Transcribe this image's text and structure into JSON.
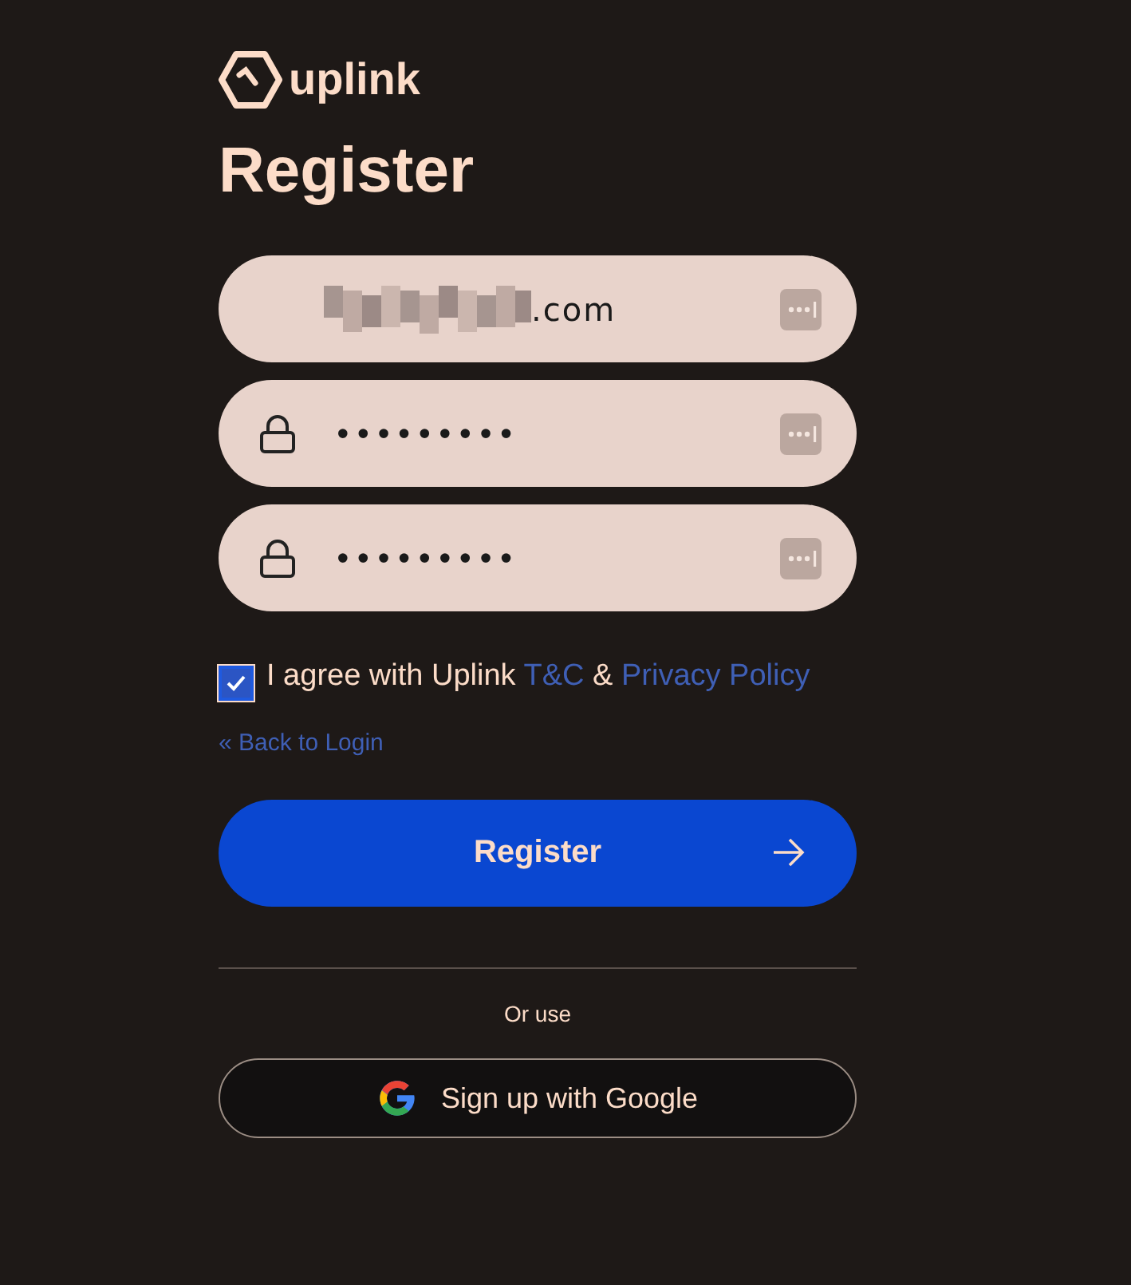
{
  "brand": {
    "name": "uplink"
  },
  "title": "Register",
  "fields": [
    {
      "kind": "email",
      "value": ".com",
      "redacted": true
    },
    {
      "kind": "password",
      "value": "•••••••••"
    },
    {
      "kind": "password",
      "value": "•••••••••"
    }
  ],
  "agree": {
    "checked": true,
    "text": "I agree with Uplink",
    "links": [
      "T&C",
      "Privacy Policy"
    ],
    "joiner": "&"
  },
  "back_link": "« Back to Login",
  "submit": {
    "label": "Register"
  },
  "divider_text": "Or use",
  "google_button": {
    "label": "Sign up with Google"
  }
}
